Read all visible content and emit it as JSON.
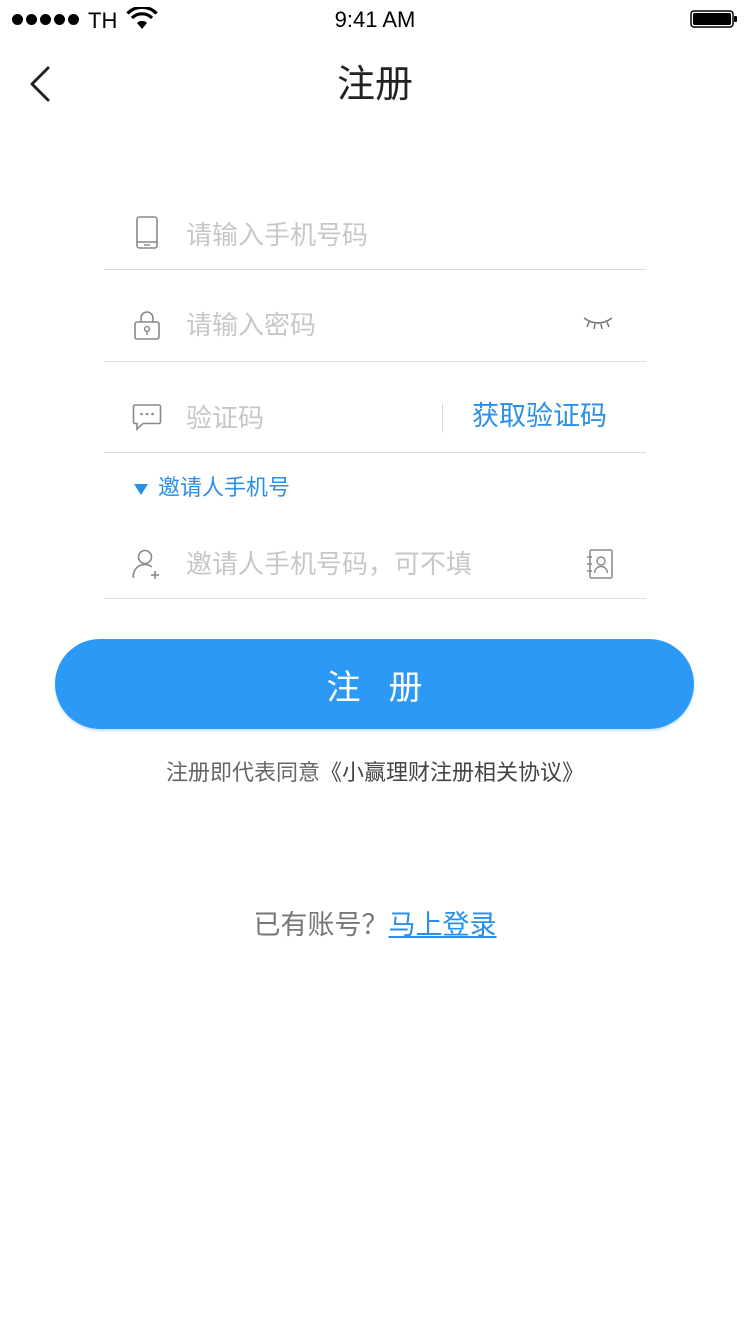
{
  "status_bar": {
    "carrier": "TH",
    "time": "9:41 AM"
  },
  "nav": {
    "title": "注册",
    "back_icon": "chevron-left-icon"
  },
  "form": {
    "phone": {
      "placeholder": "请输入手机号码",
      "icon": "phone-icon"
    },
    "password": {
      "placeholder": "请输入密码",
      "icon": "lock-icon",
      "toggle_icon": "eye-closed-icon"
    },
    "code": {
      "placeholder": "验证码",
      "icon": "message-icon",
      "get_code_label": "获取验证码"
    },
    "invite_toggle_label": "邀请人手机号",
    "invite": {
      "placeholder": "邀请人手机号码，可不填",
      "icon": "add-user-icon",
      "contact_icon": "contacts-icon"
    }
  },
  "register_button_label": "注册",
  "agreement": {
    "prefix": "注册即代表同意",
    "link": "《小赢理财注册相关协议》"
  },
  "login": {
    "prompt": "已有账号？",
    "link": "马上登录"
  },
  "colors": {
    "accent": "#2a8fe8",
    "button": "#2b99f5",
    "divider": "#dcdcdc",
    "placeholder": "#c7c7c7"
  }
}
